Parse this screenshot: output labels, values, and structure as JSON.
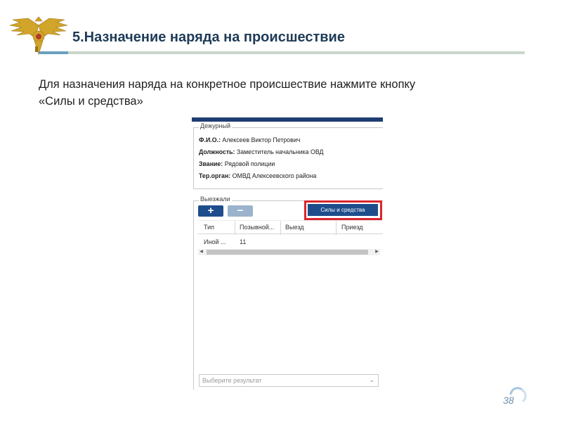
{
  "header": {
    "title": "5.Назначение наряда на происшествие"
  },
  "instruction": {
    "line1": "Для назначения наряда на конкретное происшествие нажмите кнопку",
    "line2": "«Силы и средства»"
  },
  "app": {
    "duty_section": {
      "legend": "Дежурный",
      "fio_label": "Ф.И.О.:",
      "fio_value": "Алексеев Виктор Петрович",
      "position_label": "Должность:",
      "position_value": "Заместитель начальника ОВД",
      "rank_label": "Звание:",
      "rank_value": "Рядовой полиции",
      "terorgan_label": "Тер.орган:",
      "terorgan_value": "ОМВД Алексеевского района"
    },
    "dispatch_section": {
      "legend": "Выезжали",
      "add_icon": "plus-icon",
      "add_label": "+",
      "remove_icon": "minus-icon",
      "remove_label": "−",
      "forces_button": "Силы и средства",
      "columns": [
        "Тип",
        "Позывной...",
        "Выезд",
        "Приезд"
      ],
      "rows": [
        {
          "type": "Иной ...",
          "callsign": "11",
          "departure": "",
          "arrival": ""
        }
      ]
    },
    "result_select": {
      "placeholder": "Выберите результат",
      "icon": "chevron-down-icon"
    }
  },
  "footer": {
    "page_number": "38"
  },
  "colors": {
    "title": "#1f3b57",
    "app_primary": "#1e4d8c",
    "highlight": "#d9262c",
    "page_number": "#6a8fb0"
  }
}
